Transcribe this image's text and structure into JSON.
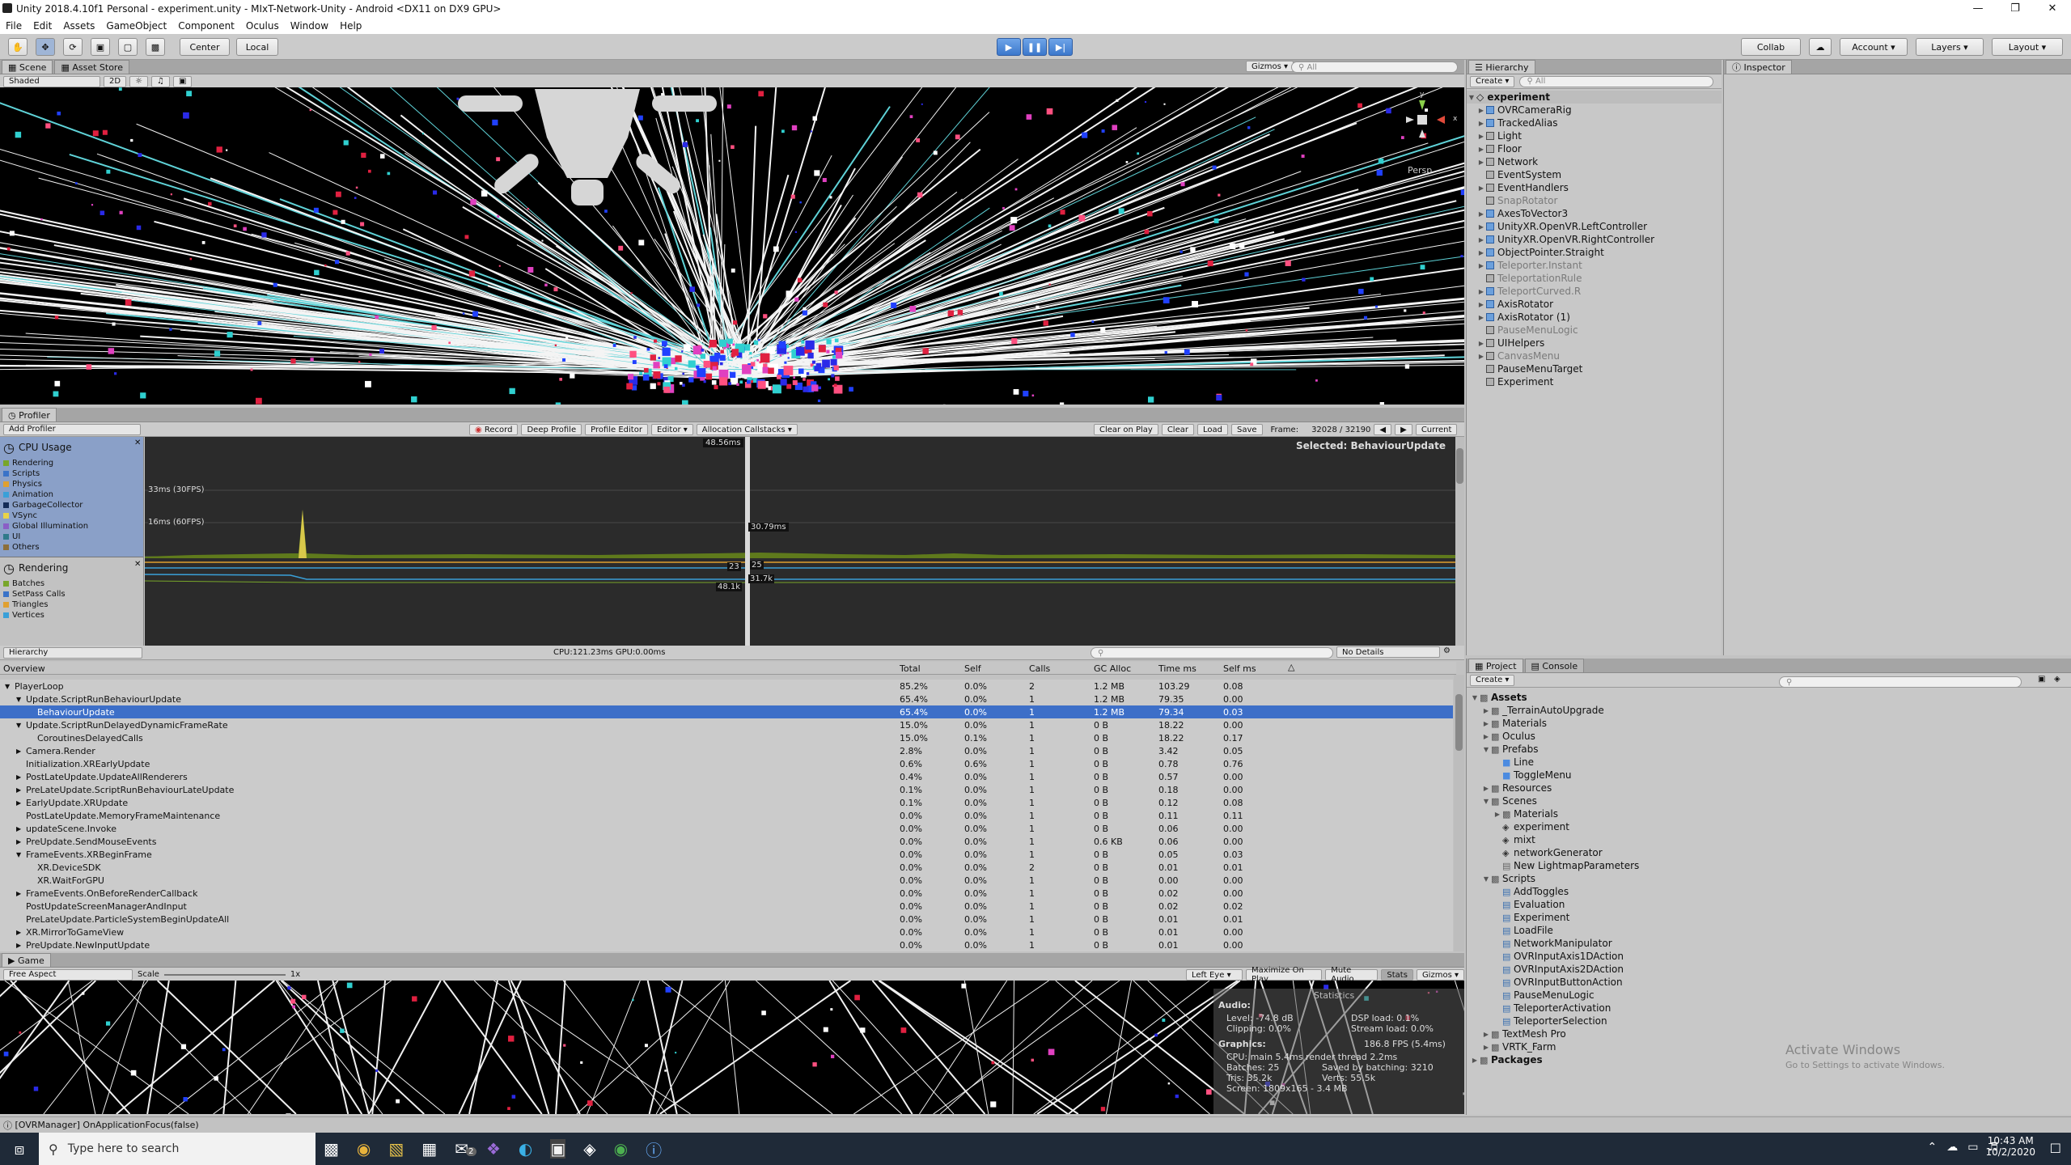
{
  "window": {
    "title": "Unity 2018.4.10f1 Personal - experiment.unity - MIxT-Network-Unity - Android <DX11 on DX9 GPU>"
  },
  "menu": [
    "File",
    "Edit",
    "Assets",
    "GameObject",
    "Component",
    "Oculus",
    "Window",
    "Help"
  ],
  "toolbar": {
    "pivot": "Center",
    "space": "Local",
    "collab": "Collab",
    "account": "Account",
    "layers": "Layers",
    "layout": "Layout"
  },
  "scene": {
    "tabs": [
      "Scene",
      "Asset Store"
    ],
    "shading": "Shaded",
    "mode2d": "2D",
    "gizmos": "Gizmos",
    "search_placeholder": "All",
    "persp": "Persp",
    "gizmo_axes": [
      "y",
      "x"
    ]
  },
  "hierarchy": {
    "tab": "Hierarchy",
    "create": "Create",
    "search_placeholder": "All",
    "scene": "experiment",
    "items": [
      {
        "label": "OVRCameraRig",
        "arrow": true,
        "dim": false,
        "icon": "blue"
      },
      {
        "label": "TrackedAlias",
        "arrow": true,
        "dim": false,
        "icon": "blue"
      },
      {
        "label": "Light",
        "arrow": true,
        "dim": false,
        "icon": "grey"
      },
      {
        "label": "Floor",
        "arrow": true,
        "dim": false,
        "icon": "grey"
      },
      {
        "label": "Network",
        "arrow": true,
        "dim": false,
        "icon": "grey"
      },
      {
        "label": "EventSystem",
        "arrow": false,
        "dim": false,
        "icon": "grey"
      },
      {
        "label": "EventHandlers",
        "arrow": true,
        "dim": false,
        "icon": "grey"
      },
      {
        "label": "SnapRotator",
        "arrow": false,
        "dim": true,
        "icon": "grey"
      },
      {
        "label": "AxesToVector3",
        "arrow": true,
        "dim": false,
        "icon": "blue"
      },
      {
        "label": "UnityXR.OpenVR.LeftController",
        "arrow": true,
        "dim": false,
        "icon": "blue"
      },
      {
        "label": "UnityXR.OpenVR.RightController",
        "arrow": true,
        "dim": false,
        "icon": "blue"
      },
      {
        "label": "ObjectPointer.Straight",
        "arrow": true,
        "dim": false,
        "icon": "blue"
      },
      {
        "label": "Teleporter.Instant",
        "arrow": true,
        "dim": true,
        "icon": "blue"
      },
      {
        "label": "TeleportationRule",
        "arrow": false,
        "dim": true,
        "icon": "grey"
      },
      {
        "label": "TeleportCurved.R",
        "arrow": true,
        "dim": true,
        "icon": "blue"
      },
      {
        "label": "AxisRotator",
        "arrow": true,
        "dim": false,
        "icon": "blue"
      },
      {
        "label": "AxisRotator (1)",
        "arrow": true,
        "dim": false,
        "icon": "blue"
      },
      {
        "label": "PauseMenuLogic",
        "arrow": false,
        "dim": true,
        "icon": "grey"
      },
      {
        "label": "UIHelpers",
        "arrow": true,
        "dim": false,
        "icon": "grey"
      },
      {
        "label": "CanvasMenu",
        "arrow": true,
        "dim": true,
        "icon": "grey"
      },
      {
        "label": "PauseMenuTarget",
        "arrow": false,
        "dim": false,
        "icon": "grey"
      },
      {
        "label": "Experiment",
        "arrow": false,
        "dim": false,
        "icon": "grey"
      }
    ]
  },
  "inspector": {
    "tab": "Inspector"
  },
  "profiler": {
    "tab": "Profiler",
    "add_profiler": "Add Profiler",
    "record": "Record",
    "deep_profile": "Deep Profile",
    "profile_editor": "Profile Editor",
    "editor": "Editor",
    "allocation": "Allocation Callstacks",
    "clear_on_play": "Clear on Play",
    "clear": "Clear",
    "load": "Load",
    "save": "Save",
    "frame_label": "Frame:",
    "frame_value": "32028 / 32190",
    "current": "Current",
    "cpu_title": "CPU Usage",
    "cpu_legend": [
      {
        "label": "Rendering",
        "color": "#78a62a"
      },
      {
        "label": "Scripts",
        "color": "#3a73c8"
      },
      {
        "label": "Physics",
        "color": "#e0a030"
      },
      {
        "label": "Animation",
        "color": "#3aa0d8"
      },
      {
        "label": "GarbageCollector",
        "color": "#132b57"
      },
      {
        "label": "VSync",
        "color": "#e8d348"
      },
      {
        "label": "Global Illumination",
        "color": "#8a5ec6"
      },
      {
        "label": "UI",
        "color": "#2f7a8a"
      },
      {
        "label": "Others",
        "color": "#8c6e3a"
      }
    ],
    "render_title": "Rendering",
    "render_legend": [
      {
        "label": "Batches",
        "color": "#78a62a"
      },
      {
        "label": "SetPass Calls",
        "color": "#3a73c8"
      },
      {
        "label": "Triangles",
        "color": "#e0a030"
      },
      {
        "label": "Vertices",
        "color": "#3aa0d8"
      }
    ],
    "selected": "Selected: BehaviourUpdate",
    "fps30": "33ms (30FPS)",
    "fps60": "16ms (60FPS)",
    "marker_top": "48.56ms",
    "marker_mid": "30.79ms",
    "marker_a": "23",
    "marker_b": "25",
    "marker_c": "48.1k",
    "marker_d": "31.7k",
    "view_mode": "Hierarchy",
    "cpu_gpu": "CPU:121.23ms  GPU:0.00ms",
    "no_details": "No Details",
    "columns": [
      "Overview",
      "Total",
      "Self",
      "Calls",
      "GC Alloc",
      "Time ms",
      "Self ms"
    ],
    "rows": [
      {
        "name": "PlayerLoop",
        "indent": 0,
        "arrow": "▼",
        "total": "85.2%",
        "self": "0.0%",
        "calls": "2",
        "gc": "1.2 MB",
        "time": "103.29",
        "selfms": "0.08",
        "sel": false
      },
      {
        "name": "Update.ScriptRunBehaviourUpdate",
        "indent": 1,
        "arrow": "▼",
        "total": "65.4%",
        "self": "0.0%",
        "calls": "1",
        "gc": "1.2 MB",
        "time": "79.35",
        "selfms": "0.00",
        "sel": false
      },
      {
        "name": "BehaviourUpdate",
        "indent": 2,
        "arrow": "",
        "total": "65.4%",
        "self": "0.0%",
        "calls": "1",
        "gc": "1.2 MB",
        "time": "79.34",
        "selfms": "0.03",
        "sel": true
      },
      {
        "name": "Update.ScriptRunDelayedDynamicFrameRate",
        "indent": 1,
        "arrow": "▼",
        "total": "15.0%",
        "self": "0.0%",
        "calls": "1",
        "gc": "0 B",
        "time": "18.22",
        "selfms": "0.00",
        "sel": false
      },
      {
        "name": "CoroutinesDelayedCalls",
        "indent": 2,
        "arrow": "",
        "total": "15.0%",
        "self": "0.1%",
        "calls": "1",
        "gc": "0 B",
        "time": "18.22",
        "selfms": "0.17",
        "sel": false
      },
      {
        "name": "Camera.Render",
        "indent": 1,
        "arrow": "▶",
        "total": "2.8%",
        "self": "0.0%",
        "calls": "1",
        "gc": "0 B",
        "time": "3.42",
        "selfms": "0.05",
        "sel": false
      },
      {
        "name": "Initialization.XREarlyUpdate",
        "indent": 1,
        "arrow": "",
        "total": "0.6%",
        "self": "0.6%",
        "calls": "1",
        "gc": "0 B",
        "time": "0.78",
        "selfms": "0.76",
        "sel": false
      },
      {
        "name": "PostLateUpdate.UpdateAllRenderers",
        "indent": 1,
        "arrow": "▶",
        "total": "0.4%",
        "self": "0.0%",
        "calls": "1",
        "gc": "0 B",
        "time": "0.57",
        "selfms": "0.00",
        "sel": false
      },
      {
        "name": "PreLateUpdate.ScriptRunBehaviourLateUpdate",
        "indent": 1,
        "arrow": "▶",
        "total": "0.1%",
        "self": "0.0%",
        "calls": "1",
        "gc": "0 B",
        "time": "0.18",
        "selfms": "0.00",
        "sel": false
      },
      {
        "name": "EarlyUpdate.XRUpdate",
        "indent": 1,
        "arrow": "▶",
        "total": "0.1%",
        "self": "0.0%",
        "calls": "1",
        "gc": "0 B",
        "time": "0.12",
        "selfms": "0.08",
        "sel": false
      },
      {
        "name": "PostLateUpdate.MemoryFrameMaintenance",
        "indent": 1,
        "arrow": "",
        "total": "0.0%",
        "self": "0.0%",
        "calls": "1",
        "gc": "0 B",
        "time": "0.11",
        "selfms": "0.11",
        "sel": false
      },
      {
        "name": "updateScene.Invoke",
        "indent": 1,
        "arrow": "▶",
        "total": "0.0%",
        "self": "0.0%",
        "calls": "1",
        "gc": "0 B",
        "time": "0.06",
        "selfms": "0.00",
        "sel": false
      },
      {
        "name": "PreUpdate.SendMouseEvents",
        "indent": 1,
        "arrow": "▶",
        "total": "0.0%",
        "self": "0.0%",
        "calls": "1",
        "gc": "0.6 KB",
        "time": "0.06",
        "selfms": "0.00",
        "sel": false
      },
      {
        "name": "FrameEvents.XRBeginFrame",
        "indent": 1,
        "arrow": "▼",
        "total": "0.0%",
        "self": "0.0%",
        "calls": "1",
        "gc": "0 B",
        "time": "0.05",
        "selfms": "0.03",
        "sel": false
      },
      {
        "name": "XR.DeviceSDK",
        "indent": 2,
        "arrow": "",
        "total": "0.0%",
        "self": "0.0%",
        "calls": "2",
        "gc": "0 B",
        "time": "0.01",
        "selfms": "0.01",
        "sel": false
      },
      {
        "name": "XR.WaitForGPU",
        "indent": 2,
        "arrow": "",
        "total": "0.0%",
        "self": "0.0%",
        "calls": "1",
        "gc": "0 B",
        "time": "0.00",
        "selfms": "0.00",
        "sel": false
      },
      {
        "name": "FrameEvents.OnBeforeRenderCallback",
        "indent": 1,
        "arrow": "▶",
        "total": "0.0%",
        "self": "0.0%",
        "calls": "1",
        "gc": "0 B",
        "time": "0.02",
        "selfms": "0.00",
        "sel": false
      },
      {
        "name": "PostUpdateScreenManagerAndInput",
        "indent": 1,
        "arrow": "",
        "total": "0.0%",
        "self": "0.0%",
        "calls": "1",
        "gc": "0 B",
        "time": "0.02",
        "selfms": "0.02",
        "sel": false
      },
      {
        "name": "PreLateUpdate.ParticleSystemBeginUpdateAll",
        "indent": 1,
        "arrow": "",
        "total": "0.0%",
        "self": "0.0%",
        "calls": "1",
        "gc": "0 B",
        "time": "0.01",
        "selfms": "0.01",
        "sel": false
      },
      {
        "name": "XR.MirrorToGameView",
        "indent": 1,
        "arrow": "▶",
        "total": "0.0%",
        "self": "0.0%",
        "calls": "1",
        "gc": "0 B",
        "time": "0.01",
        "selfms": "0.00",
        "sel": false
      },
      {
        "name": "PreUpdate.NewInputUpdate",
        "indent": 1,
        "arrow": "▶",
        "total": "0.0%",
        "self": "0.0%",
        "calls": "1",
        "gc": "0 B",
        "time": "0.01",
        "selfms": "0.00",
        "sel": false
      }
    ]
  },
  "game": {
    "tab": "Game",
    "aspect": "Free Aspect",
    "scale_label": "Scale",
    "scale_value": "1x",
    "eye": "Left Eye",
    "maximize": "Maximize On Play",
    "mute": "Mute Audio",
    "stats": "Stats",
    "gizmos": "Gizmos",
    "stats_panel": {
      "heading": "Statistics",
      "audio": "Audio:",
      "level": "Level: -74.8 dB",
      "clipping": "Clipping: 0.0%",
      "dsp": "DSP load: 0.1%",
      "stream": "Stream load: 0.0%",
      "graphics": "Graphics:",
      "fps": "186.8 FPS (5.4ms)",
      "cpu": "CPU: main 5.4ms  render thread 2.2ms",
      "batches": "Batches: 25",
      "saved": "Saved by batching: 3210",
      "tris": "Tris: 35.2k",
      "verts": "Verts: 55.5k",
      "screen": "Screen: 1809x165 - 3.4 MB"
    }
  },
  "project": {
    "tabs": [
      "Project",
      "Console"
    ],
    "create": "Create",
    "tree": [
      {
        "label": "Assets",
        "indent": 0,
        "arrow": "▼",
        "type": "folder",
        "bold": true
      },
      {
        "label": "_TerrainAutoUpgrade",
        "indent": 1,
        "arrow": "▶",
        "type": "folder",
        "bold": false
      },
      {
        "label": "Materials",
        "indent": 1,
        "arrow": "▶",
        "type": "folder",
        "bold": false
      },
      {
        "label": "Oculus",
        "indent": 1,
        "arrow": "▶",
        "type": "folder",
        "bold": false
      },
      {
        "label": "Prefabs",
        "indent": 1,
        "arrow": "▼",
        "type": "folder",
        "bold": false
      },
      {
        "label": "Line",
        "indent": 2,
        "arrow": "",
        "type": "prefab",
        "bold": false
      },
      {
        "label": "ToggleMenu",
        "indent": 2,
        "arrow": "",
        "type": "prefab",
        "bold": false
      },
      {
        "label": "Resources",
        "indent": 1,
        "arrow": "▶",
        "type": "folder",
        "bold": false
      },
      {
        "label": "Scenes",
        "indent": 1,
        "arrow": "▼",
        "type": "folder",
        "bold": false
      },
      {
        "label": "Materials",
        "indent": 2,
        "arrow": "▶",
        "type": "folder",
        "bold": false
      },
      {
        "label": "experiment",
        "indent": 2,
        "arrow": "",
        "type": "scene",
        "bold": false
      },
      {
        "label": "mixt",
        "indent": 2,
        "arrow": "",
        "type": "scene",
        "bold": false
      },
      {
        "label": "networkGenerator",
        "indent": 2,
        "arrow": "",
        "type": "scene",
        "bold": false
      },
      {
        "label": "New LightmapParameters",
        "indent": 2,
        "arrow": "",
        "type": "file",
        "bold": false
      },
      {
        "label": "Scripts",
        "indent": 1,
        "arrow": "▼",
        "type": "folder",
        "bold": false
      },
      {
        "label": "AddToggles",
        "indent": 2,
        "arrow": "",
        "type": "script",
        "bold": false
      },
      {
        "label": "Evaluation",
        "indent": 2,
        "arrow": "",
        "type": "script",
        "bold": false
      },
      {
        "label": "Experiment",
        "indent": 2,
        "arrow": "",
        "type": "script",
        "bold": false
      },
      {
        "label": "LoadFile",
        "indent": 2,
        "arrow": "",
        "type": "script",
        "bold": false
      },
      {
        "label": "NetworkManipulator",
        "indent": 2,
        "arrow": "",
        "type": "script",
        "bold": false
      },
      {
        "label": "OVRInputAxis1DAction",
        "indent": 2,
        "arrow": "",
        "type": "script",
        "bold": false
      },
      {
        "label": "OVRInputAxis2DAction",
        "indent": 2,
        "arrow": "",
        "type": "script",
        "bold": false
      },
      {
        "label": "OVRInputButtonAction",
        "indent": 2,
        "arrow": "",
        "type": "script",
        "bold": false
      },
      {
        "label": "PauseMenuLogic",
        "indent": 2,
        "arrow": "",
        "type": "script",
        "bold": false
      },
      {
        "label": "TeleporterActivation",
        "indent": 2,
        "arrow": "",
        "type": "script",
        "bold": false
      },
      {
        "label": "TeleporterSelection",
        "indent": 2,
        "arrow": "",
        "type": "script",
        "bold": false
      },
      {
        "label": "TextMesh Pro",
        "indent": 1,
        "arrow": "▶",
        "type": "folder",
        "bold": false
      },
      {
        "label": "VRTK_Farm",
        "indent": 1,
        "arrow": "▶",
        "type": "folder",
        "bold": false
      },
      {
        "label": "Packages",
        "indent": 0,
        "arrow": "▶",
        "type": "folder",
        "bold": true
      }
    ],
    "watermark1": "Activate Windows",
    "watermark2": "Go to Settings to activate Windows."
  },
  "console_status": "[OVRManager] OnApplicationFocus(false)",
  "taskbar": {
    "search_placeholder": "Type here to search",
    "time": "10:43 AM",
    "date": "10/2/2020",
    "badge": "2"
  }
}
